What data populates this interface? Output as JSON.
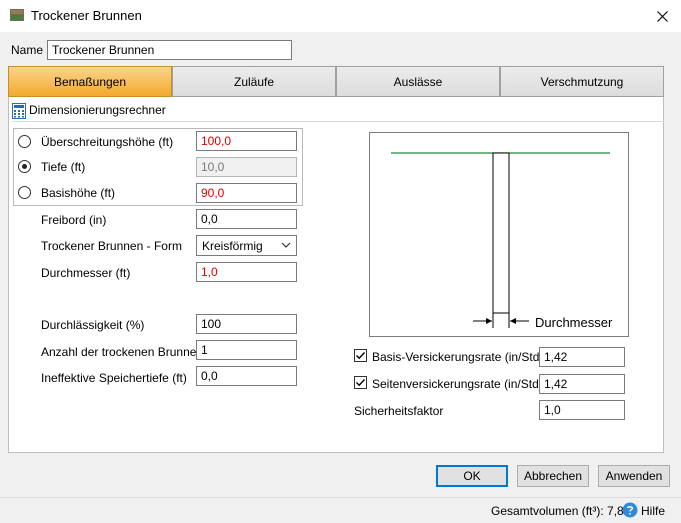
{
  "window": {
    "title": "Trockener Brunnen"
  },
  "name_field": {
    "label": "Name",
    "value": "Trockener Brunnen"
  },
  "tabs": [
    {
      "label": "Bemaßungen",
      "active": true
    },
    {
      "label": "Zuläufe",
      "active": false
    },
    {
      "label": "Auslässe",
      "active": false
    },
    {
      "label": "Verschmutzung",
      "active": false
    }
  ],
  "section": {
    "title": "Dimensionierungsrechner"
  },
  "radio_group": [
    {
      "label": "Überschreitungshöhe (ft)",
      "value": "100,0",
      "checked": false
    },
    {
      "label": "Tiefe (ft)",
      "value": "10,0",
      "checked": true
    },
    {
      "label": "Basishöhe (ft)",
      "value": "90,0",
      "checked": false
    }
  ],
  "fields": {
    "freibord": {
      "label": "Freibord (in)",
      "value": "0,0"
    },
    "form": {
      "label": "Trockener Brunnen - Form",
      "value": "Kreisförmig"
    },
    "durchmesser": {
      "label": "Durchmesser (ft)",
      "value": "1,0"
    },
    "durchlaessigkeit": {
      "label": "Durchlässigkeit (%)",
      "value": "100"
    },
    "anzahl": {
      "label": "Anzahl der trockenen Brunnen",
      "value": "1"
    },
    "speichertiefe": {
      "label": "Ineffektive Speichertiefe (ft)",
      "value": "0,0"
    }
  },
  "diagram": {
    "dimension_label": "Durchmesser"
  },
  "rates": {
    "basis": {
      "label": "Basis-Versickerungsrate (in/Std.)",
      "value": "1,42",
      "checked": true
    },
    "seiten": {
      "label": "Seitenversickerungsrate (in/Std.)",
      "value": "1,42",
      "checked": true
    },
    "sicherheit": {
      "label": "Sicherheitsfaktor",
      "value": "1,0"
    }
  },
  "buttons": {
    "ok": "OK",
    "cancel": "Abbrechen",
    "apply": "Anwenden"
  },
  "footer": {
    "volume_label": "Gesamtvolumen (ft³):",
    "volume_value": "7,854",
    "help_label": "Hilfe"
  },
  "colors": {
    "active_tab": "#f3a92e",
    "red_value": "#e00000",
    "ground_line": "#1f8a3c",
    "help_icon": "#2e8ad8"
  }
}
